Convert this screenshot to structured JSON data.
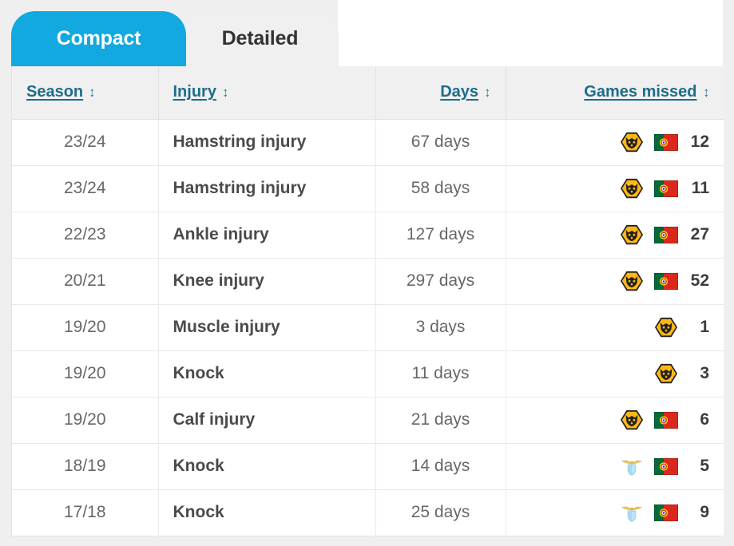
{
  "tabs": [
    {
      "label": "Compact",
      "active": true
    },
    {
      "label": "Detailed",
      "active": false
    }
  ],
  "table": {
    "columns": [
      {
        "key": "season",
        "label": "Season",
        "sort_icon": "↕"
      },
      {
        "key": "injury",
        "label": "Injury",
        "sort_icon": "↕"
      },
      {
        "key": "days",
        "label": "Days",
        "sort_icon": "↕"
      },
      {
        "key": "games_missed",
        "label": "Games missed",
        "sort_icon": "↕"
      }
    ],
    "rows": [
      {
        "season": "23/24",
        "injury": "Hamstring injury",
        "days": "67 days",
        "club_icon": "wolverhampton-wanderers-crest",
        "flag_icon": "portugal-flag",
        "games_missed": "12"
      },
      {
        "season": "23/24",
        "injury": "Hamstring injury",
        "days": "58 days",
        "club_icon": "wolverhampton-wanderers-crest",
        "flag_icon": "portugal-flag",
        "games_missed": "11"
      },
      {
        "season": "22/23",
        "injury": "Ankle injury",
        "days": "127 days",
        "club_icon": "wolverhampton-wanderers-crest",
        "flag_icon": "portugal-flag",
        "games_missed": "27"
      },
      {
        "season": "20/21",
        "injury": "Knee injury",
        "days": "297 days",
        "club_icon": "wolverhampton-wanderers-crest",
        "flag_icon": "portugal-flag",
        "games_missed": "52"
      },
      {
        "season": "19/20",
        "injury": "Muscle injury",
        "days": "3 days",
        "club_icon": "wolverhampton-wanderers-crest",
        "flag_icon": null,
        "games_missed": "1"
      },
      {
        "season": "19/20",
        "injury": "Knock",
        "days": "11 days",
        "club_icon": "wolverhampton-wanderers-crest",
        "flag_icon": null,
        "games_missed": "3"
      },
      {
        "season": "19/20",
        "injury": "Calf injury",
        "days": "21 days",
        "club_icon": "wolverhampton-wanderers-crest",
        "flag_icon": "portugal-flag",
        "games_missed": "6"
      },
      {
        "season": "18/19",
        "injury": "Knock",
        "days": "14 days",
        "club_icon": "lazio-crest",
        "flag_icon": "portugal-flag",
        "games_missed": "5"
      },
      {
        "season": "17/18",
        "injury": "Knock",
        "days": "25 days",
        "club_icon": "lazio-crest",
        "flag_icon": "portugal-flag",
        "games_missed": "9"
      }
    ]
  },
  "colors": {
    "active_tab": "#12A8E0",
    "inactive_tab": "#F0F0F0",
    "header_link": "#1D6D8C",
    "page_background": "#EFEFEF",
    "row_background": "#FFFFFF",
    "wolves_gold": "#FDB913",
    "portugal_green": "#046A38",
    "portugal_red": "#DA291C",
    "lazio_blue": "#87CEEB"
  }
}
